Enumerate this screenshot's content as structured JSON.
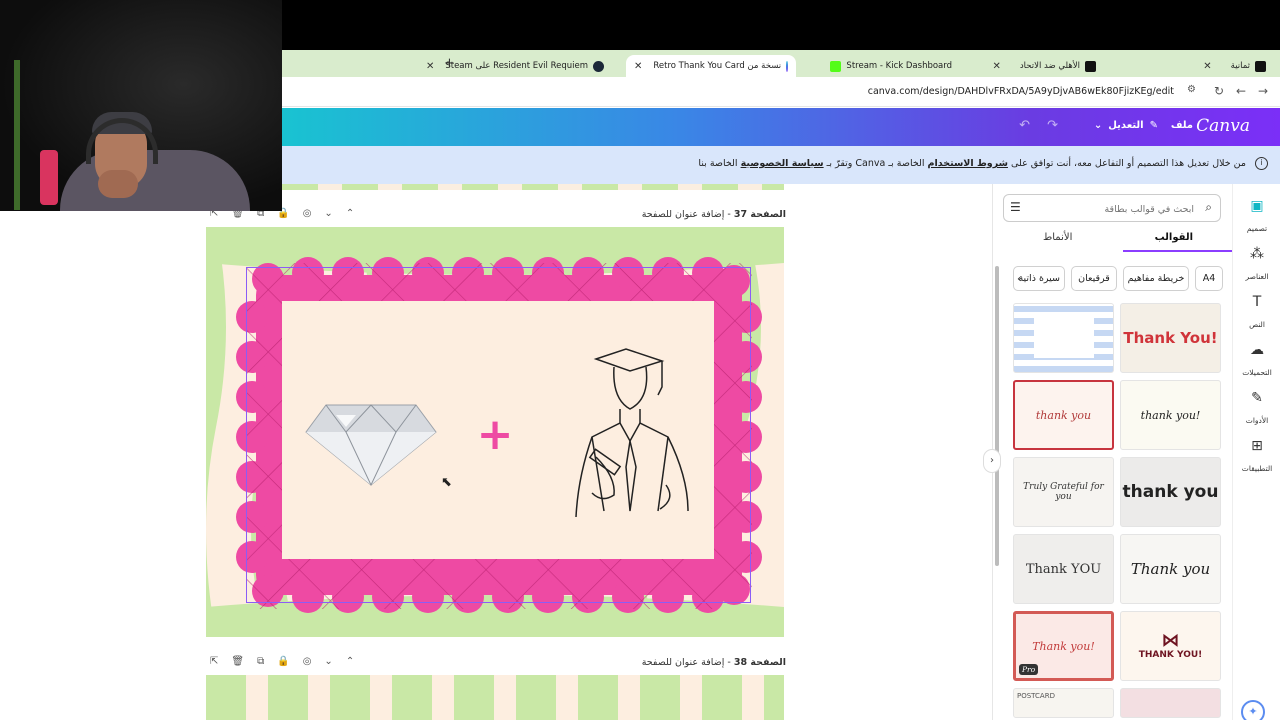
{
  "browser": {
    "tabs": [
      {
        "title": "ثمانية",
        "active": false
      },
      {
        "title": "الأهلي ضد الاتحاد",
        "active": false
      },
      {
        "title": "Stream - Kick Dashboard",
        "active": false
      },
      {
        "title": "نسخة من Retro Thank You Card",
        "active": true
      },
      {
        "title": "Resident Evil Requiem على Steam",
        "active": false
      }
    ],
    "new_tab": "+",
    "url": "canva.com/design/DAHDlvFRxDA/5A9yDjvAB6wEk80FjizKEg/edit"
  },
  "canva": {
    "logo": "Canva",
    "file_menu": "ملف",
    "edit_menu": "التعديل"
  },
  "notice": {
    "prefix": "من خلال تعديل هذا التصميم أو التفاعل معه، أنت توافق على",
    "terms": "شروط الاستخدام",
    "middle": "الخاصة بـ Canva وتقرّ بـ",
    "privacy": "سياسة الخصوصية",
    "suffix": "الخاصة بنا"
  },
  "pages": [
    {
      "number": "الصفحة 37",
      "title": "إضافة عنوان للصفحة"
    },
    {
      "number": "الصفحة 38",
      "title": "إضافة عنوان للصفحة"
    }
  ],
  "design": {
    "plus_sign": "+"
  },
  "panel": {
    "search_placeholder": "ابحث في قوالب بطاقة",
    "tabs": [
      "القوالب",
      "الأنماط"
    ],
    "chips": [
      "A4",
      "خريطة مفاهيم",
      "قرقيعان",
      "سيرة ذاتية"
    ],
    "templates": [
      {
        "text": "",
        "style": "blue-plaid"
      },
      {
        "text": "Thank You!",
        "style": "bold-retro"
      },
      {
        "text": "thank you",
        "style": "cupcake"
      },
      {
        "text": "thank you!",
        "style": "script-cream"
      },
      {
        "text": "Truly Grateful for you",
        "style": "grateful"
      },
      {
        "text": "thank you",
        "style": "bold-black"
      },
      {
        "text": "Thank YOU",
        "style": "serif-grey"
      },
      {
        "text": "Thank you",
        "style": "heart-script"
      },
      {
        "text": "Thank you!",
        "style": "stamp-red",
        "badge": "Pro"
      },
      {
        "text": "THANK YOU!",
        "style": "bow"
      },
      {
        "text": "POSTCARD",
        "style": "postcard"
      },
      {
        "text": "",
        "style": "pink-bottom"
      }
    ]
  },
  "rail": [
    {
      "label": "تصميم",
      "icon": "design-icon"
    },
    {
      "label": "العناصر",
      "icon": "elements-icon"
    },
    {
      "label": "النص",
      "icon": "text-icon"
    },
    {
      "label": "التحميلات",
      "icon": "uploads-icon"
    },
    {
      "label": "الأدوات",
      "icon": "tools-icon"
    },
    {
      "label": "التطبيقات",
      "icon": "apps-icon"
    }
  ],
  "colors": {
    "canva_purple": "#7b2ff7",
    "canva_teal": "#19c3d1",
    "frame_pink": "#ee4aa3",
    "stripe_green": "#c9e8a6",
    "stripe_cream": "#fdeee0",
    "notice_bg": "#d9e6fb"
  }
}
